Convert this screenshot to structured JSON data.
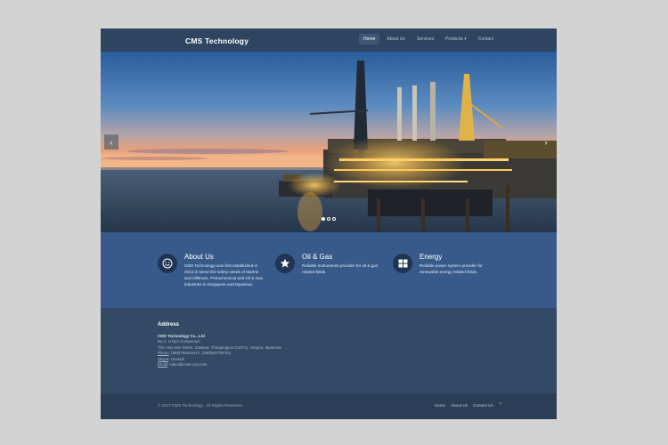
{
  "header": {
    "brand": "CMS Technology",
    "nav": [
      {
        "label": "Home",
        "active": true
      },
      {
        "label": "About Us"
      },
      {
        "label": "Services"
      },
      {
        "label": "Products ▾"
      },
      {
        "label": "Contact"
      }
    ]
  },
  "hero": {
    "prev_arrow": "‹",
    "next_arrow": "›",
    "slide_count": 3,
    "active_slide": 1
  },
  "features": [
    {
      "icon": "smiley-icon",
      "title": "About Us",
      "text": "CMS Technology was first established in 2013 to serve the safety needs of Marine and Offshore, Petrochemical and Oil & Gas industries in Singapore and Myanmar."
    },
    {
      "icon": "star-icon",
      "title": "Oil & Gas",
      "text": "Reliable instruments provider for oil & gas related fields."
    },
    {
      "icon": "grid-icon",
      "title": "Energy",
      "text": "Reliable power system provider for renewable energy related fields."
    }
  ],
  "address": {
    "heading": "Address",
    "company": "CMS Technology Co., Ltd",
    "line1": "No.1, U Nyo Compound,",
    "line2": "Thin Hay Mar Street, Zawana, Thingangyun (11071), Yangon, Myanmar",
    "phone_label": "Phone",
    "phone": ": (959)795810427, (959)962705762",
    "skype_label": "Skype",
    "skype": ": cmsedn",
    "email_label": "Email",
    "email": ": sales@cmst.com.mm"
  },
  "footer": {
    "copyright": "© 2017 CMS Technology . All Rights Reserved.",
    "links": [
      "Home",
      "About Us",
      "Contact Us"
    ],
    "top_arrow": "⌃"
  },
  "colors": {
    "page_bg": "#d3d3d3",
    "header_bg": "#2f4460",
    "features_bg": "#385a8a",
    "footer_bg": "#334a66",
    "footer_bottom_bg": "#2b3e57"
  }
}
